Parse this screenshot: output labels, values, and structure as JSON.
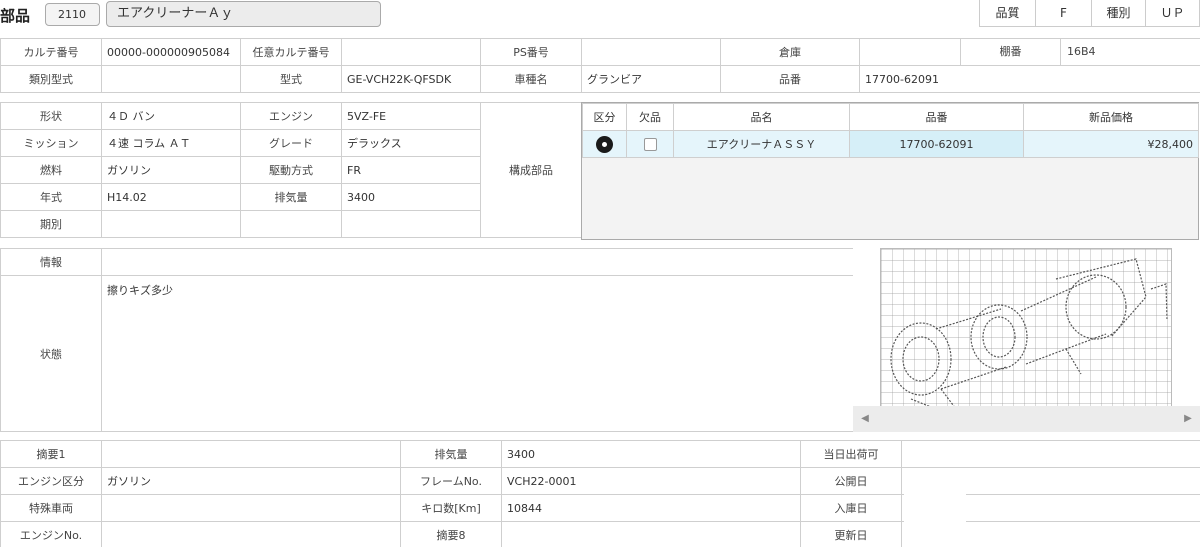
{
  "header": {
    "title": "部品",
    "code": "2110",
    "part_name": "エアクリーナーＡｙ",
    "quality_label": "品質",
    "quality_value": "F",
    "kind_label": "種別",
    "kind_value": "ＵＰ"
  },
  "info1": {
    "karte_no_label": "カルテ番号",
    "karte_no": "00000-000000905084",
    "opt_karte_label": "任意カルテ番号",
    "opt_karte": "",
    "ps_label": "PS番号",
    "ps": "",
    "warehouse_label": "倉庫",
    "warehouse": "",
    "shelf_label": "棚番",
    "shelf": "16B4",
    "class_type_label": "類別型式",
    "class_type": "",
    "model_label": "型式",
    "model": "GE-VCH22K-QFSDK",
    "car_name_label": "車種名",
    "car_name": "グランビア",
    "part_no_label": "品番",
    "part_no": "17700-62091"
  },
  "info2": {
    "shape_label": "形状",
    "shape": "４Ｄ バン",
    "engine_label": "エンジン",
    "engine": "5VZ-FE",
    "mission_label": "ミッション",
    "mission": "４速 コラム ＡＴ",
    "grade_label": "グレード",
    "grade": "デラックス",
    "fuel_label": "燃料",
    "fuel": "ガソリン",
    "drive_label": "駆動方式",
    "drive": "FR",
    "year_label": "年式",
    "year": "H14.02",
    "displacement_label": "排気量",
    "displacement": "3400",
    "period_label": "期別",
    "period": "",
    "components_label": "構成部品"
  },
  "parts": {
    "headers": [
      "区分",
      "欠品",
      "品名",
      "品番",
      "新品価格"
    ],
    "rows": [
      {
        "name": "エアクリーナＡＳＳＹ",
        "number": "17700-62091",
        "price": "¥28,400"
      }
    ]
  },
  "notes": {
    "info_label": "情報",
    "info": "",
    "condition_label": "状態",
    "condition": "擦りキズ多少"
  },
  "image_panel": {
    "prev_icon": "chevron-left-icon",
    "next_icon": "chevron-right-icon"
  },
  "bottom": {
    "summary1_label": "摘要1",
    "summary1": "",
    "displacement_label": "排気量",
    "displacement": "3400",
    "same_day_label": "当日出荷可",
    "same_day": "",
    "engine_type_label": "エンジン区分",
    "engine_type": "ガソリン",
    "frame_label": "フレームNo.",
    "frame": "VCH22-0001",
    "publish_label": "公開日",
    "publish": "",
    "special_label": "特殊車両",
    "special": "",
    "km_label": "キロ数[Km]",
    "km": "10844",
    "stock_label": "入庫日",
    "stock": "",
    "engine_no_label": "エンジンNo.",
    "engine_no": "",
    "summary8_label": "摘要8",
    "summary8": "",
    "updated_label": "更新日",
    "updated": ""
  }
}
